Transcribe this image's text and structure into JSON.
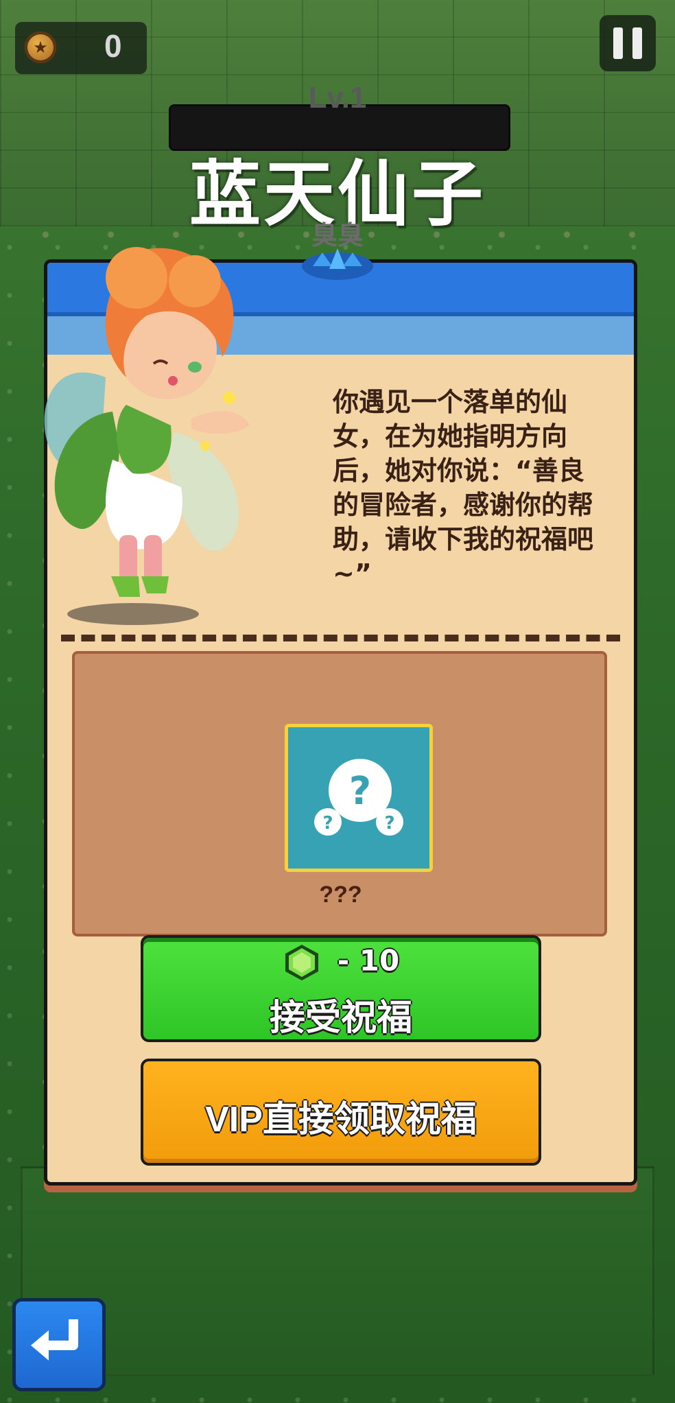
{
  "hud": {
    "coin_count": "0",
    "coin_icon": "star-coin-icon",
    "pause_icon": "pause-icon"
  },
  "event": {
    "level": "Lv.1",
    "title": "蓝天仙子",
    "tag": "臭臭"
  },
  "dialog": {
    "story": "你遇见一个落单的仙女，在为她指明方向后，她对你说：“善良的冒险者，感谢你的帮助，请收下我的祝福吧~”",
    "reward": {
      "name": "???",
      "icon": "mystery-question-icon"
    },
    "accept_button": {
      "cost": "- 10",
      "cost_icon": "green-gem-icon",
      "label": "接受祝福"
    },
    "vip_button": {
      "label": "VIP直接领取祝福"
    }
  },
  "nav": {
    "back_icon": "return-arrow-icon"
  },
  "colors": {
    "panel_bg": "#f3d5a6",
    "header_blue": "#2b79e0",
    "accept_green": "#2ec526",
    "vip_orange": "#f29c0a",
    "reward_card": "#38a2b5"
  }
}
